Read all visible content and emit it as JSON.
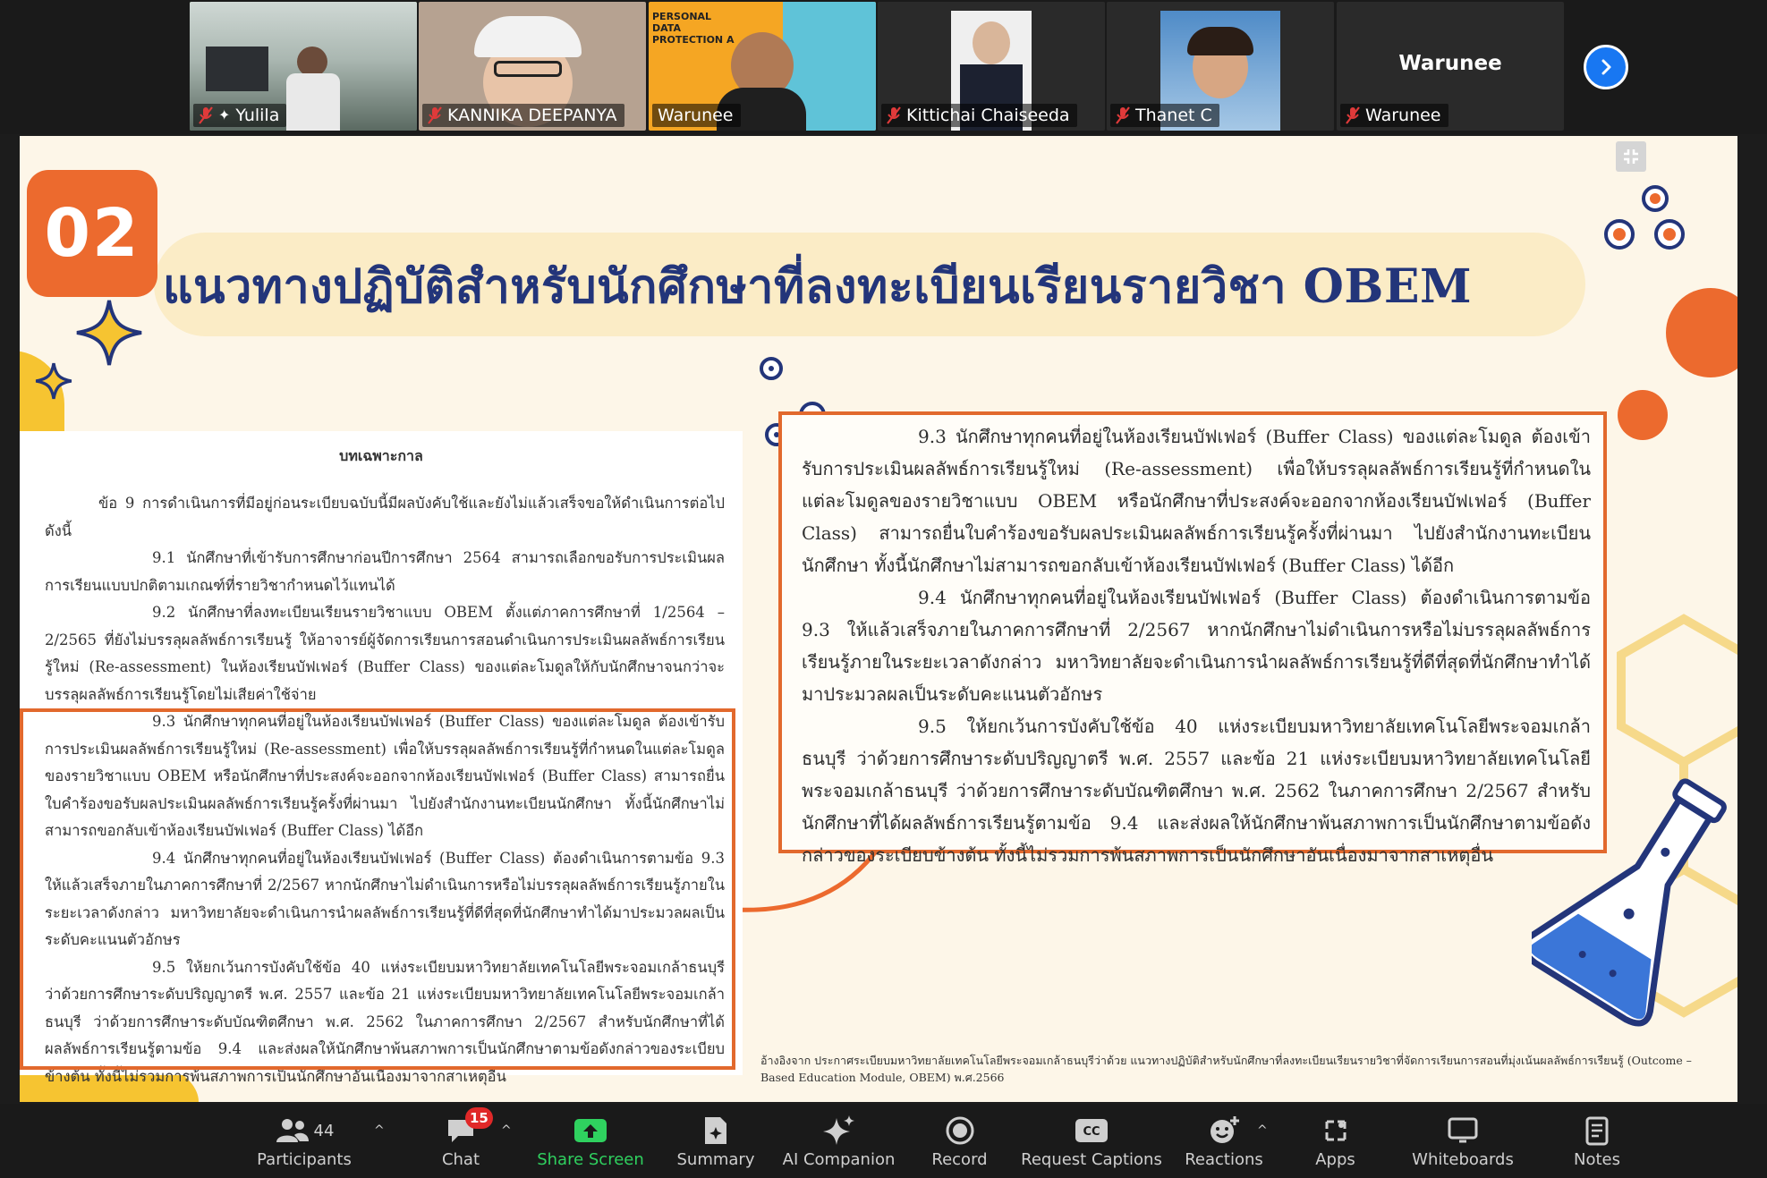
{
  "participants": [
    {
      "name": "Yulila",
      "muted": true,
      "active": true,
      "video": "office"
    },
    {
      "name": "KANNIKA DEEPANYA",
      "muted": true,
      "active": false,
      "video": "person-cap"
    },
    {
      "name": "Warunee",
      "muted": false,
      "active": false,
      "video": "pdpa-slide"
    },
    {
      "name": "Kittichai Chaiseeda",
      "muted": true,
      "active": false,
      "video": "person-suit"
    },
    {
      "name": "Thanet C",
      "muted": true,
      "active": false,
      "video": "person-sky"
    },
    {
      "name": "Warunee",
      "muted": true,
      "active": false,
      "video": "name-only"
    }
  ],
  "video_overlay_text": "PERSONAL DATA PROTECTION A",
  "slide": {
    "badge": "02",
    "title": "แนวทางปฏิบัติสำหรับนักศึกษาที่ลงทะเบียนเรียนรายวิชา OBEM",
    "doc_heading": "บทเฉพาะกาล",
    "doc_paragraphs": [
      "ข้อ 9 การดำเนินการที่มีอยู่ก่อนระเบียบฉบับนี้มีผลบังคับใช้และยังไม่แล้วเสร็จขอให้ดำเนินการต่อไป ดังนี้",
      "9.1 นักศึกษาที่เข้ารับการศึกษาก่อนปีการศึกษา 2564 สามารถเลือกขอรับการประเมินผลการเรียนแบบปกติตามเกณฑ์ที่รายวิชากำหนดไว้แทนได้",
      "9.2 นักศึกษาที่ลงทะเบียนเรียนรายวิชาแบบ OBEM ตั้งแต่ภาคการศึกษาที่ 1/2564 – 2/2565 ที่ยังไม่บรรลุผลลัพธ์การเรียนรู้ ให้อาจารย์ผู้จัดการเรียนการสอนดำเนินการประเมินผลลัพธ์การเรียนรู้ใหม่ (Re-assessment) ในห้องเรียนบัฟเฟอร์ (Buffer Class) ของแต่ละโมดูลให้กับนักศึกษาจนกว่าจะบรรลุผลลัพธ์การเรียนรู้โดยไม่เสียค่าใช้จ่าย",
      "9.3 นักศึกษาทุกคนที่อยู่ในห้องเรียนบัฟเฟอร์ (Buffer Class) ของแต่ละโมดูล ต้องเข้ารับการประเมินผลลัพธ์การเรียนรู้ใหม่ (Re-assessment) เพื่อให้บรรลุผลลัพธ์การเรียนรู้ที่กำหนดในแต่ละโมดูลของรายวิชาแบบ OBEM หรือนักศึกษาที่ประสงค์จะออกจากห้องเรียนบัฟเฟอร์ (Buffer Class) สามารถยื่นใบคำร้องขอรับผลประเมินผลลัพธ์การเรียนรู้ครั้งที่ผ่านมา ไปยังสำนักงานทะเบียนนักศึกษา ทั้งนี้นักศึกษาไม่สามารถขอกลับเข้าห้องเรียนบัฟเฟอร์ (Buffer Class) ได้อีก",
      "9.4 นักศึกษาทุกคนที่อยู่ในห้องเรียนบัฟเฟอร์ (Buffer Class) ต้องดำเนินการตามข้อ 9.3 ให้แล้วเสร็จภายในภาคการศึกษาที่ 2/2567 หากนักศึกษาไม่ดำเนินการหรือไม่บรรลุผลลัพธ์การเรียนรู้ภายในระยะเวลาดังกล่าว มหาวิทยาลัยจะดำเนินการนำผลลัพธ์การเรียนรู้ที่ดีที่สุดที่นักศึกษาทำได้มาประมวลผลเป็นระดับคะแนนตัวอักษร",
      "9.5 ให้ยกเว้นการบังคับใช้ข้อ 40 แห่งระเบียบมหาวิทยาลัยเทคโนโลยีพระจอมเกล้าธนบุรี ว่าด้วยการศึกษาระดับปริญญาตรี พ.ศ. 2557 และข้อ 21 แห่งระเบียบมหาวิทยาลัยเทคโนโลยีพระจอมเกล้าธนบุรี ว่าด้วยการศึกษาระดับบัณฑิตศึกษา พ.ศ. 2562 ในภาคการศึกษา 2/2567 สำหรับนักศึกษาที่ได้ผลลัพธ์การเรียนรู้ตามข้อ 9.4 และส่งผลให้นักศึกษาพ้นสภาพการเป็นนักศึกษาตามข้อดังกล่าวของระเบียบข้างต้น ทั้งนี้ไม่รวมการพ้นสภาพการเป็นนักศึกษาอันเนื่องมาจากสาเหตุอื่น"
    ],
    "zoom_paragraphs": [
      "9.3 นักศึกษาทุกคนที่อยู่ในห้องเรียนบัฟเฟอร์ (Buffer Class) ของแต่ละโมดูล ต้องเข้ารับการประเมินผลลัพธ์การเรียนรู้ใหม่ (Re-assessment) เพื่อให้บรรลุผลลัพธ์การเรียนรู้ที่กำหนดในแต่ละโมดูลของรายวิชาแบบ OBEM หรือนักศึกษาที่ประสงค์จะออกจากห้องเรียนบัฟเฟอร์ (Buffer Class) สามารถยื่นใบคำร้องขอรับผลประเมินผลลัพธ์การเรียนรู้ครั้งที่ผ่านมา ไปยังสำนักงานทะเบียนนักศึกษา ทั้งนี้นักศึกษาไม่สามารถขอกลับเข้าห้องเรียนบัฟเฟอร์ (Buffer Class) ได้อีก",
      "9.4 นักศึกษาทุกคนที่อยู่ในห้องเรียนบัฟเฟอร์ (Buffer Class) ต้องดำเนินการตามข้อ 9.3 ให้แล้วเสร็จภายในภาคการศึกษาที่ 2/2567 หากนักศึกษาไม่ดำเนินการหรือไม่บรรลุผลลัพธ์การเรียนรู้ภายในระยะเวลาดังกล่าว มหาวิทยาลัยจะดำเนินการนำผลลัพธ์การเรียนรู้ที่ดีที่สุดที่นักศึกษาทำได้มาประมวลผลเป็นระดับคะแนนตัวอักษร",
      "9.5 ให้ยกเว้นการบังคับใช้ข้อ 40 แห่งระเบียบมหาวิทยาลัยเทคโนโลยีพระจอมเกล้าธนบุรี ว่าด้วยการศึกษาระดับปริญญาตรี พ.ศ. 2557 และข้อ 21 แห่งระเบียบมหาวิทยาลัยเทคโนโลยีพระจอมเกล้าธนบุรี ว่าด้วยการศึกษาระดับบัณฑิตศึกษา พ.ศ. 2562 ในภาคการศึกษา 2/2567 สำหรับนักศึกษาที่ได้ผลลัพธ์การเรียนรู้ตามข้อ 9.4 และส่งผลให้นักศึกษาพ้นสภาพการเป็นนักศึกษาตามข้อดังกล่าวของระเบียบข้างต้น ทั้งนี้ไม่รวมการพ้นสภาพการเป็นนักศึกษาอันเนื่องมาจากสาเหตุอื่น"
    ],
    "footnote": "อ้างอิงจาก ประกาศระเบียบมหาวิทยาลัยเทคโนโลยีพระจอมเกล้าธนบุรีว่าด้วย แนวทางปฏิบัติสำหรับนักศึกษาที่ลงทะเบียนเรียนรายวิชาที่จัดการเรียนการสอนที่มุ่งเน้นผลลัพธ์การเรียนรู้ (Outcome – Based Education Module, OBEM) พ.ศ.2566"
  },
  "toolbar": {
    "participants": {
      "label": "Participants",
      "count": "44"
    },
    "chat": {
      "label": "Chat",
      "badge": "15"
    },
    "share": {
      "label": "Share Screen"
    },
    "summary": {
      "label": "Summary"
    },
    "ai": {
      "label": "AI Companion"
    },
    "record": {
      "label": "Record"
    },
    "captions": {
      "label": "Request Captions"
    },
    "reactions": {
      "label": "Reactions"
    },
    "apps": {
      "label": "Apps"
    },
    "whiteboards": {
      "label": "Whiteboards"
    },
    "notes": {
      "label": "Notes"
    }
  },
  "colors": {
    "accent_orange": "#e2692d",
    "title_navy": "#23357a",
    "share_green": "#2fd15f",
    "active_speaker": "#58b64e",
    "chat_badge": "#e02828"
  }
}
